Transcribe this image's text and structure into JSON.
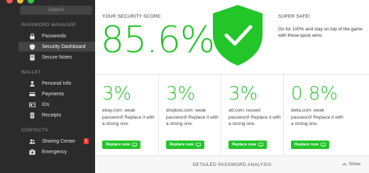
{
  "sidebar": {
    "search_placeholder": "Search",
    "sections": {
      "password_manager": "PASSWORD MANAGER",
      "wallet": "WALLET",
      "contacts": "CONTACTS"
    },
    "items": [
      {
        "label": "Passwords",
        "icon": "lock-icon"
      },
      {
        "label": "Security Dashboard",
        "icon": "shield-icon",
        "active": true
      },
      {
        "label": "Secure Notes",
        "icon": "note-icon"
      },
      {
        "label": "Personal Info",
        "icon": "person-icon"
      },
      {
        "label": "Payments",
        "icon": "credit-card-icon"
      },
      {
        "label": "IDs",
        "icon": "id-card-icon"
      },
      {
        "label": "Receipts",
        "icon": "receipt-icon"
      },
      {
        "label": "Sharing Center",
        "icon": "people-icon",
        "badge": "1"
      },
      {
        "label": "Emergency",
        "icon": "emergency-icon"
      }
    ]
  },
  "score": {
    "label": "YOUR SECURITY SCORE:",
    "value": "85.6%"
  },
  "status": {
    "title": "SUPER SAFE!",
    "description": "Go for 100% and stay on top of the game with these quick wins:"
  },
  "cards": [
    {
      "percent": "3%",
      "description": "ebay.com: weak password! Replace it with a strong one.",
      "button": "Replace now"
    },
    {
      "percent": "3%",
      "description": "dropbox.com: weak password! Replace it with a strong one.",
      "button": "Replace now"
    },
    {
      "percent": "3%",
      "description": "att.com: reused password! Replace it with a strong one.",
      "button": "Replace now"
    },
    {
      "percent": "0.8%",
      "description": "delta.com: weak password! Replace it with a strong one.",
      "button": "Replace now"
    }
  ],
  "footer": {
    "title": "DETAILED PASSWORD ANALYSIS",
    "toggle": "Show"
  },
  "colors": {
    "accent_green": "#22c629",
    "sidebar_bg": "#2b2b2b",
    "badge_red": "#ff3b30"
  }
}
